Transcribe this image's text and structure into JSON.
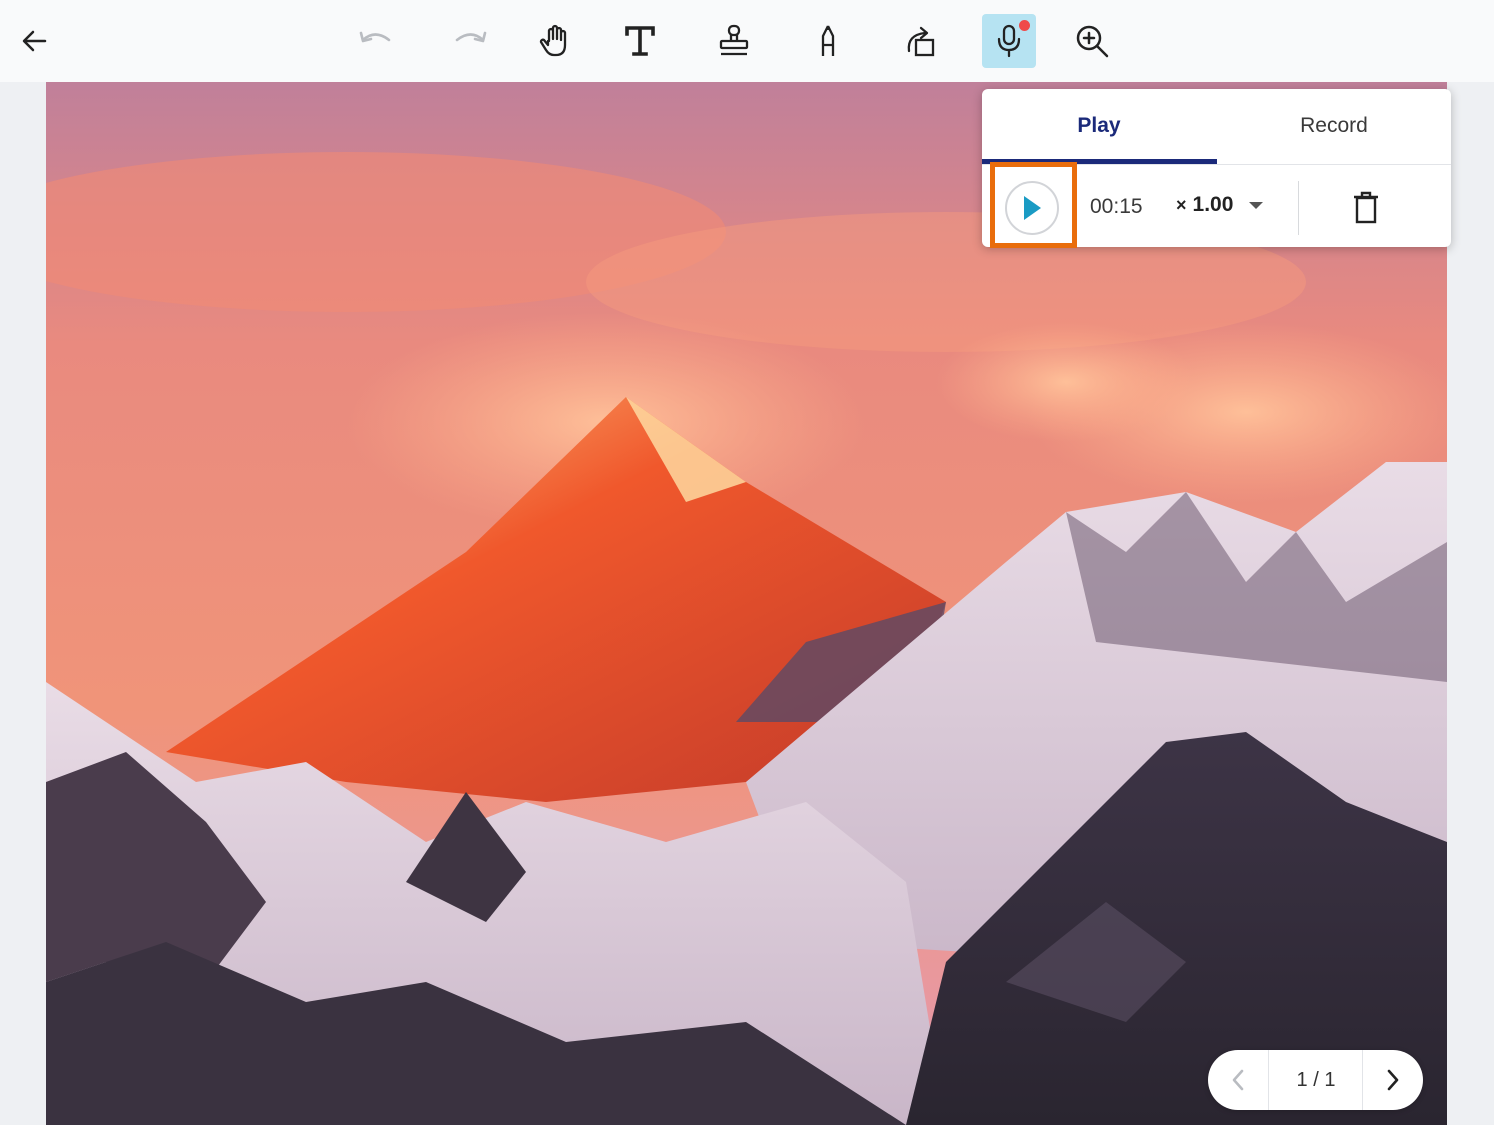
{
  "toolbar": {
    "back_icon": "arrow-left-icon",
    "tools": [
      "undo-icon",
      "redo-icon",
      "hand-icon",
      "text-icon",
      "stamp-icon",
      "pen-icon",
      "rotate-icon",
      "microphone-icon",
      "zoom-in-icon"
    ],
    "active_tool": "microphone",
    "colors": {
      "active_bg": "#b6e3f2",
      "record_dot": "#ef4a4a"
    }
  },
  "audio_panel": {
    "tabs": [
      {
        "label": "Play",
        "selected": true
      },
      {
        "label": "Record",
        "selected": false
      }
    ],
    "time": "00:15",
    "speed_prefix": "×",
    "speed_value": "1.00",
    "colors": {
      "accent": "#1b2a7a",
      "play_icon": "#1a9bc4",
      "highlight": "#e96d0c"
    }
  },
  "pager": {
    "label": "1 / 1"
  }
}
